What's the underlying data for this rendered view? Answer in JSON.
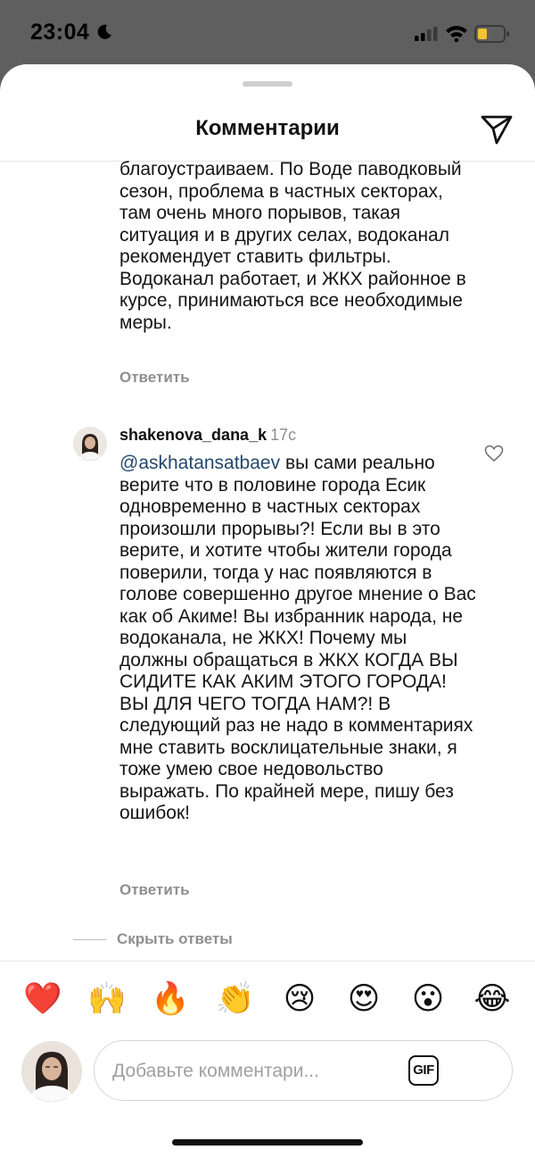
{
  "status_bar": {
    "time": "23:04"
  },
  "header": {
    "title": "Комментарии"
  },
  "comments": [
    {
      "text": "благоустраиваем. По Воде паводковый сезон, проблема в частных секторах, там очень много порывов, такая ситуация и в других селах, водоканал рекомендует ставить фильтры. Водоканал работает, и ЖКХ районное в курсе, принимаються все необходимые меры.",
      "reply_label": "Ответить"
    },
    {
      "username": "shakenova_dana_k",
      "time": "17с",
      "mention": "@askhatansatbaev",
      "text": " вы сами реально верите что в половине города Есик одновременно в частных секторах произошли прорывы?! Если вы в это верите, и хотите чтобы жители города поверили, тогда у нас появляются в голове совершенно другое мнение о Вас как об Акиме! Вы избранник народа, не водоканала, не ЖКХ! Почему мы должны обращаться в ЖКХ КОГДА ВЫ СИДИТЕ КАК АКИМ ЭТОГО ГОРОДА! ВЫ ДЛЯ ЧЕГО ТОГДА НАМ?! В следующий раз не надо в комментариях мне ставить восклицательные знаки, я тоже умею свое недовольство выражать. По крайней мере, пишу без ошибок!",
      "reply_label": "Ответить"
    }
  ],
  "hide_replies": "Скрыть ответы",
  "emoji_bar": [
    "❤️",
    "🙌",
    "🔥",
    "👏",
    "😢",
    "😍",
    "😮",
    "😂"
  ],
  "composer": {
    "placeholder": "Добавьте комментари...",
    "gif_label": "GIF"
  }
}
